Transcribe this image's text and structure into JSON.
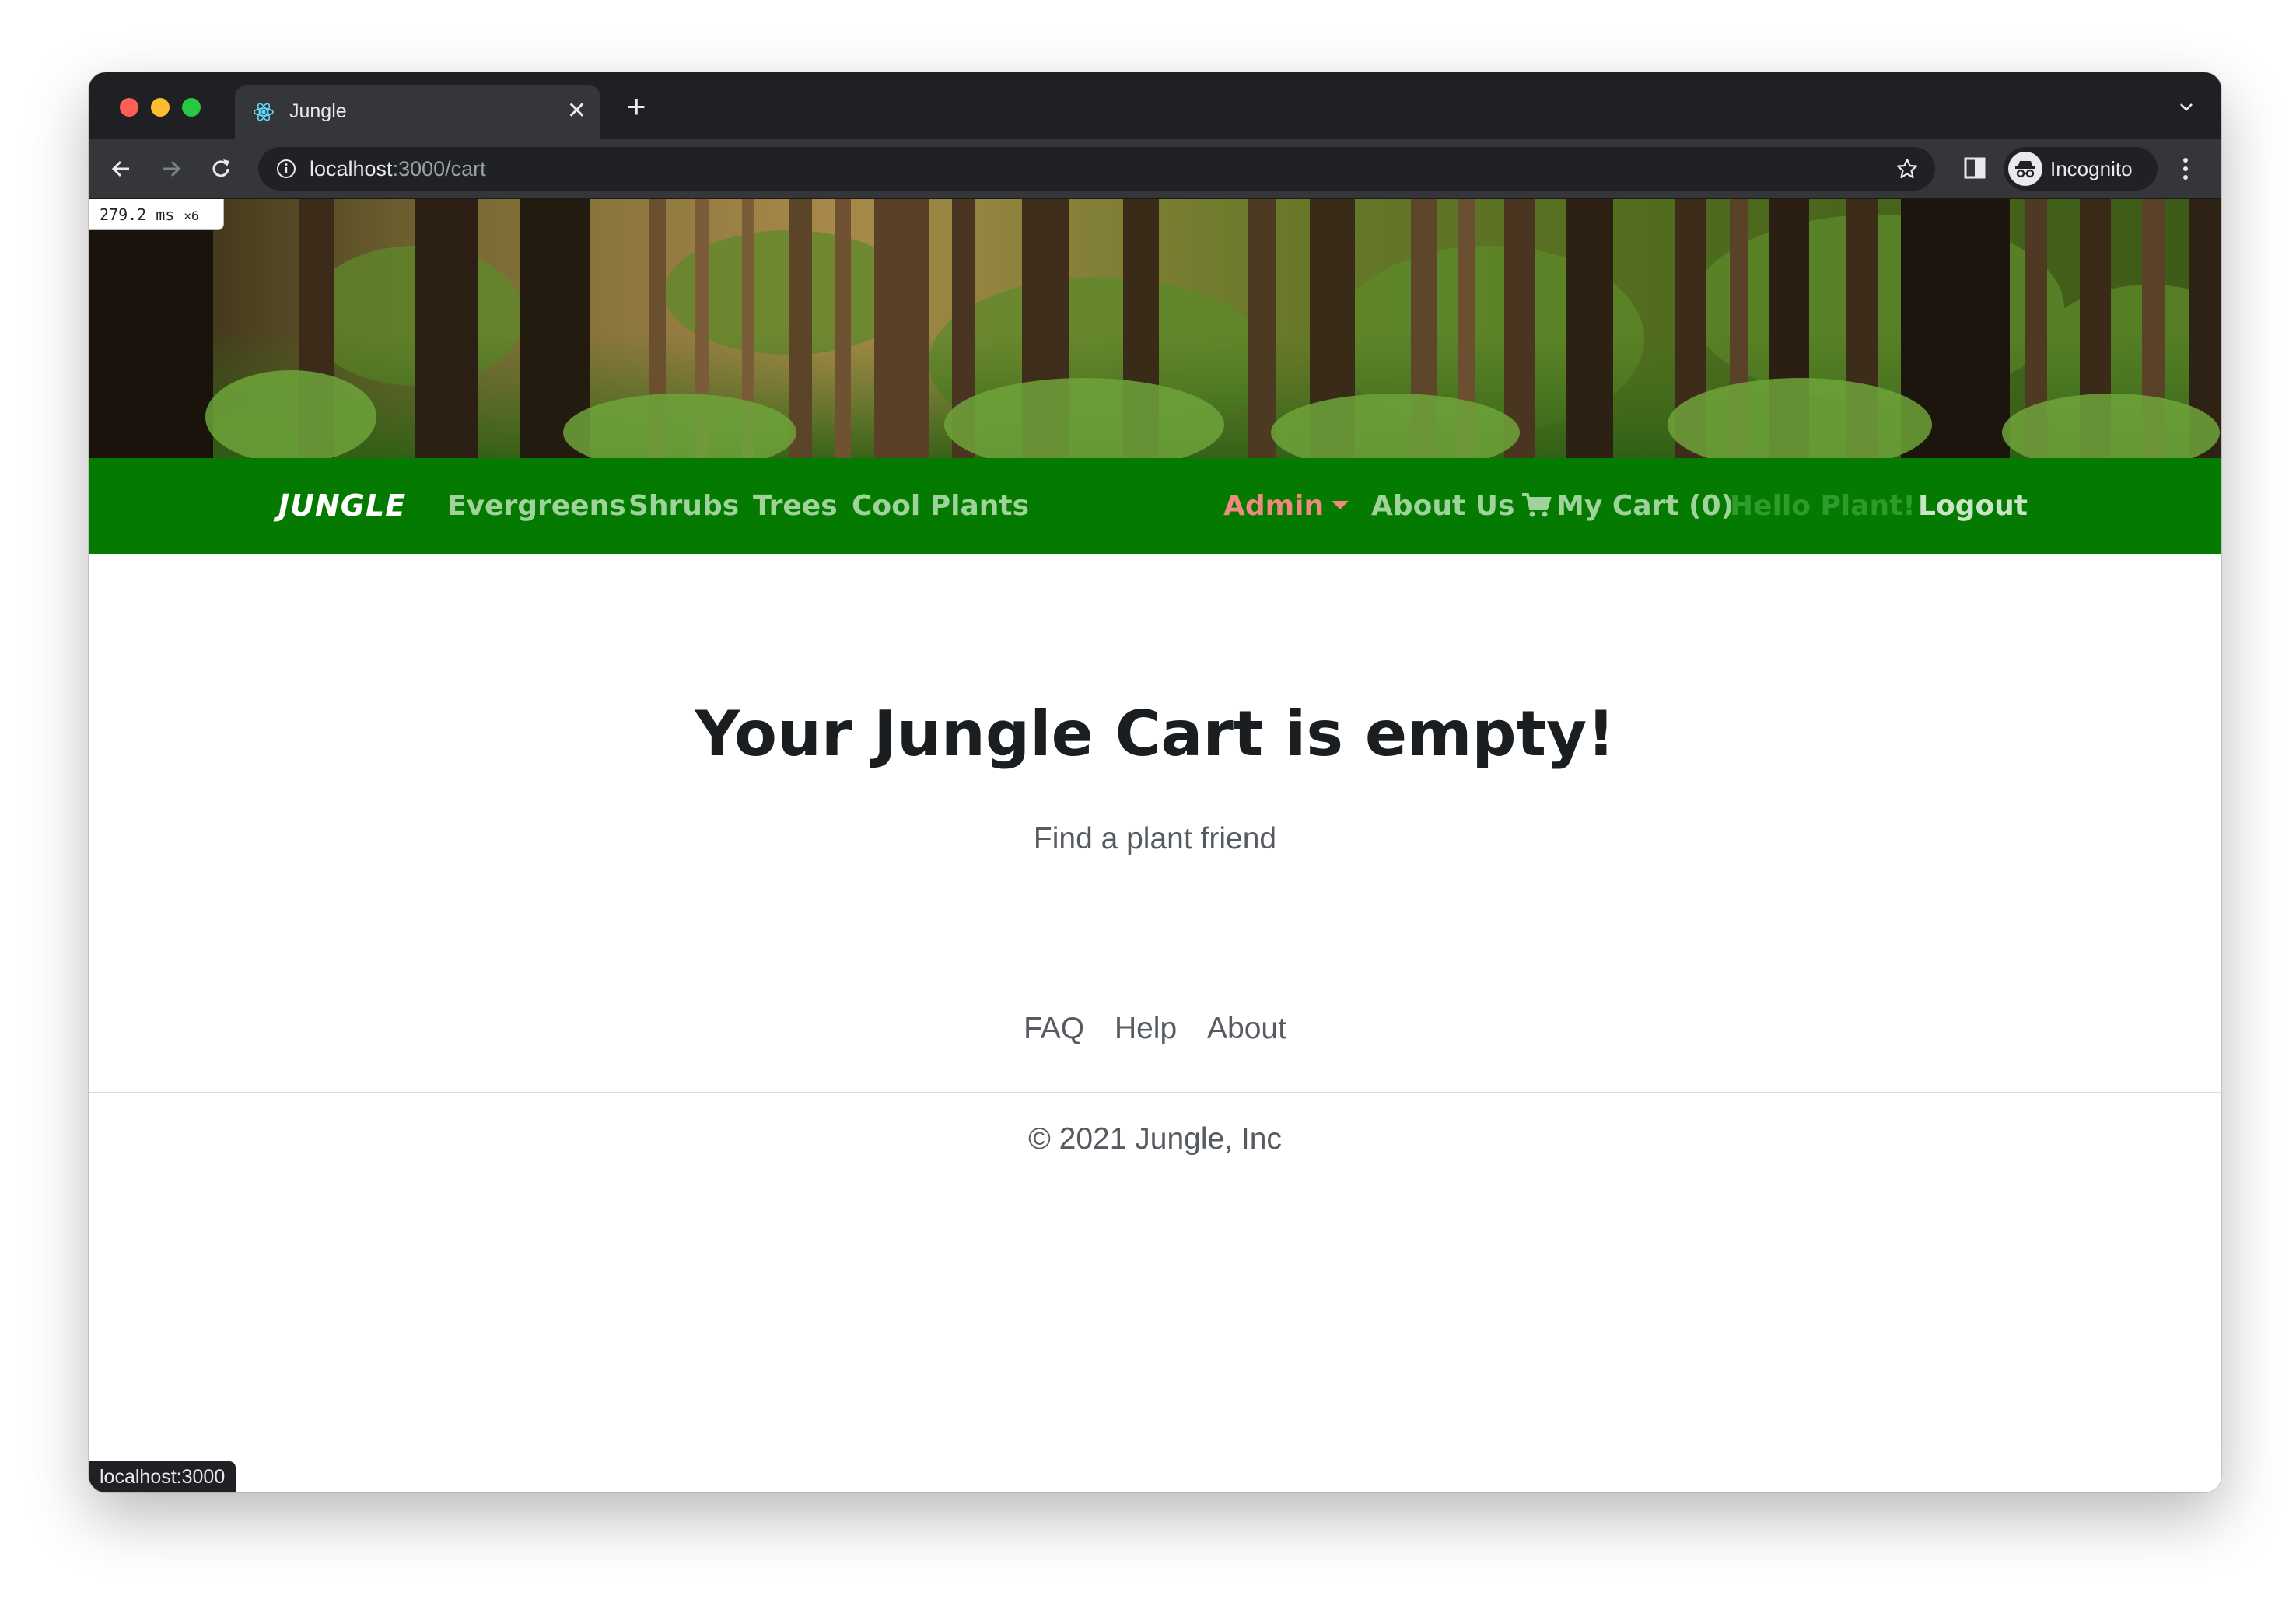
{
  "browser": {
    "tab_title": "Jungle",
    "tab_close": "✕",
    "new_tab": "+",
    "url_host": "localhost",
    "url_path": ":3000/cart",
    "profile_label": "Incognito",
    "status_url": "localhost:3000"
  },
  "devtools": {
    "timing_value": "279.2 ms",
    "timing_multiplier": "×6"
  },
  "navbar": {
    "brand": "JUNGLE",
    "links": [
      "Evergreens",
      "Shrubs",
      "Trees",
      "Cool Plants"
    ],
    "admin_label": "Admin",
    "about_label": "About Us",
    "cart_label": "My Cart (0)",
    "greeting": "Hello Plant!",
    "logout_label": "Logout",
    "colors": {
      "bar": "#047b00",
      "link": "#9fd39b",
      "admin": "#f08a80",
      "greeting": "#2e9b2a"
    }
  },
  "main": {
    "heading": "Your Jungle Cart is empty!",
    "subheading": "Find a plant friend"
  },
  "footer": {
    "links": [
      "FAQ",
      "Help",
      "About"
    ],
    "copyright": "© 2021 Jungle, Inc"
  },
  "icons": [
    "react-icon",
    "close-icon",
    "plus-icon",
    "chevron-down-icon",
    "back-arrow-icon",
    "forward-arrow-icon",
    "reload-icon",
    "info-icon",
    "star-icon",
    "side-panel-icon",
    "incognito-icon",
    "kebab-menu-icon",
    "cart-icon",
    "caret-down-icon"
  ]
}
